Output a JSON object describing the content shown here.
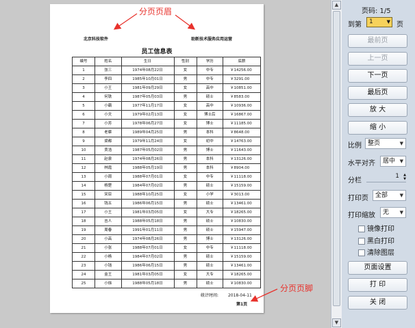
{
  "annotations": {
    "header_label": "分页页眉",
    "footer_label": "分页页脚"
  },
  "paper": {
    "header_left": "北京科技软件",
    "header_right": "助新技术服务应用运营",
    "table_title": "员工信息表",
    "columns": [
      "编号",
      "姓名",
      "生日",
      "性别",
      "学历",
      "底薪"
    ],
    "rows": [
      [
        "1",
        "张三",
        "1974年08月22日",
        "女",
        "中专",
        "￥14256.00"
      ],
      [
        "2",
        "李四",
        "1985年10月01日",
        "男",
        "中专",
        "￥3291.00"
      ],
      [
        "3",
        "小王",
        "1981年09月29日",
        "女",
        "高中",
        "￥10851.00"
      ],
      [
        "4",
        "何铁",
        "1987年05月03日",
        "男",
        "硕士",
        "￥8583.00"
      ],
      [
        "5",
        "小霸",
        "1977年11月17日",
        "女",
        "高中",
        "￥10936.00"
      ],
      [
        "6",
        "小文",
        "1979年02月13日",
        "女",
        "博士后",
        "￥16867.00"
      ],
      [
        "7",
        "小芳",
        "1978年06月27日",
        "女",
        "博士",
        "￥11185.00"
      ],
      [
        "8",
        "老蔡",
        "1989年04月25日",
        "男",
        "本科",
        "￥8648.00"
      ],
      [
        "9",
        "梁都",
        "1979年11月24日",
        "女",
        "初中",
        "￥14763.00"
      ],
      [
        "10",
        "贾浩",
        "1987年05月02日",
        "男",
        "博士",
        "￥11643.00"
      ],
      [
        "11",
        "赵泉",
        "1974年08月26日",
        "男",
        "本科",
        "￥13126.00"
      ],
      [
        "12",
        "林霞",
        "1988年05月19日",
        "男",
        "本科",
        "￥8904.00"
      ],
      [
        "13",
        "小周",
        "1988年07月01日",
        "女",
        "中专",
        "￥11118.00"
      ],
      [
        "14",
        "杨楚",
        "1984年07月02日",
        "男",
        "硕士",
        "￥15159.00"
      ],
      [
        "15",
        "宋亚",
        "1988年10月25日",
        "女",
        "小学",
        "￥3013.00"
      ],
      [
        "16",
        "钱五",
        "1986年06月15日",
        "男",
        "硕士",
        "￥13461.00"
      ],
      [
        "17",
        "小王",
        "1981年03月05日",
        "女",
        "大专",
        "￥18265.00"
      ],
      [
        "18",
        "吉人",
        "1988年05月18日",
        "男",
        "硕士",
        "￥10830.00"
      ],
      [
        "19",
        "周春",
        "1991年01月11日",
        "男",
        "硕士",
        "￥15947.00"
      ],
      [
        "20",
        "小高",
        "1974年08月26日",
        "男",
        "博士",
        "￥13126.00"
      ],
      [
        "21",
        "小张",
        "1988年07月01日",
        "女",
        "中专",
        "￥11118.00"
      ],
      [
        "22",
        "小杨",
        "1984年07月02日",
        "男",
        "硕士",
        "￥15159.00"
      ],
      [
        "23",
        "小钱",
        "1986年06月15日",
        "男",
        "硕士",
        "￥13461.00"
      ],
      [
        "24",
        "金王",
        "1981年03月05日",
        "女",
        "大专",
        "￥18265.00"
      ],
      [
        "25",
        "小徐",
        "1988年05月18日",
        "男",
        "硕士",
        "￥10830.00"
      ]
    ],
    "print_time_label": "统计时间:",
    "print_time_value": "2018-04-11",
    "page_footer": "第1页"
  },
  "panel": {
    "page_counter": "页码: 1/5",
    "goto_prefix": "到第",
    "goto_value": "1",
    "goto_suffix": "页",
    "buttons": {
      "first": "最前页",
      "prev": "上一页",
      "next": "下一页",
      "last": "最后页",
      "zoom_in": "放 大",
      "zoom_out": "缩 小",
      "page_setup": "页面设置",
      "print": "打 印",
      "close": "关 闭"
    },
    "scale_label": "比例",
    "scale_value": "整页",
    "align_label": "水平对齐",
    "align_value": "居中",
    "columns_label": "分栏",
    "columns_value": "1",
    "print_pages_label": "打印页",
    "print_pages_value": "全部",
    "print_scale_label": "打印缩放",
    "print_scale_value": "无",
    "options": {
      "mirror": "镜像打印",
      "bw": "黑白打印",
      "clear_layers": "清除图层"
    }
  },
  "colors": {
    "annotation": "#e8322c",
    "panel_bg": "#d2dbe6",
    "goto_highlight": "#f7d25b"
  }
}
